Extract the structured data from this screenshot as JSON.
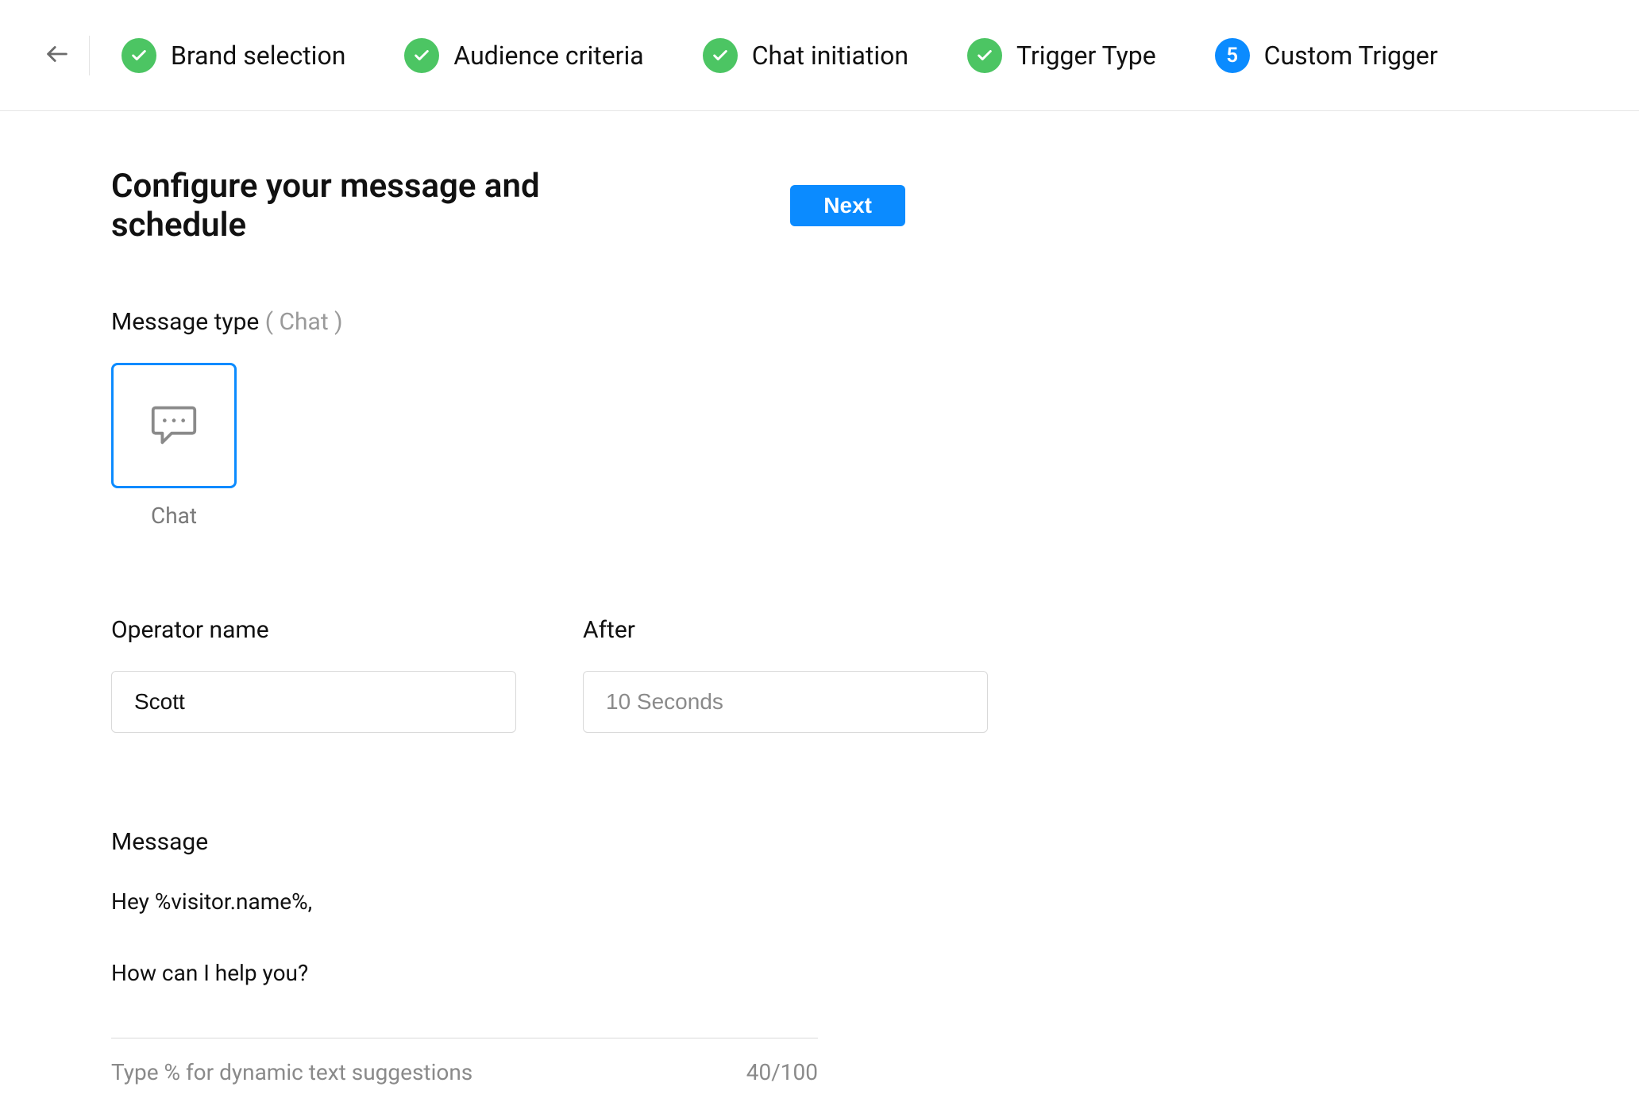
{
  "stepper": {
    "steps": [
      {
        "label": "Brand selection",
        "state": "done"
      },
      {
        "label": "Audience criteria",
        "state": "done"
      },
      {
        "label": "Chat initiation",
        "state": "done"
      },
      {
        "label": "Trigger Type",
        "state": "done"
      },
      {
        "label": "Custom Trigger",
        "state": "current",
        "number": "5"
      }
    ]
  },
  "page": {
    "title": "Configure your message and schedule",
    "next_label": "Next"
  },
  "message_type": {
    "label": "Message type",
    "selected_paren": "( Chat )",
    "option_label": "Chat"
  },
  "form": {
    "operator_name_label": "Operator name",
    "operator_name_value": "Scott",
    "after_label": "After",
    "after_value": "10 Seconds"
  },
  "message": {
    "label": "Message",
    "value": "Hey %visitor.name%,\n\nHow can I help you?",
    "hint": "Type % for dynamic text suggestions",
    "counter": "40/100"
  }
}
